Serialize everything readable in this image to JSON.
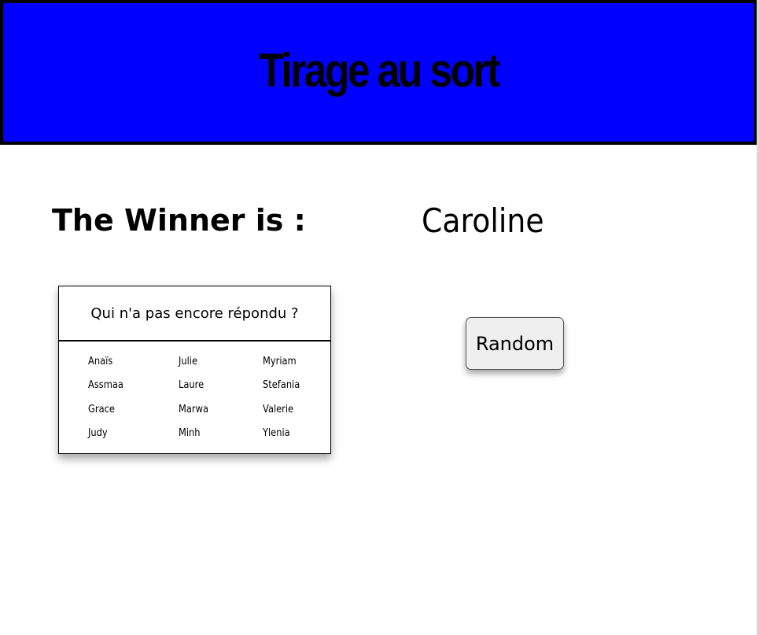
{
  "header": {
    "title": "Tirage au sort",
    "background_color": "#0000ff"
  },
  "winner": {
    "label": "The Winner is :",
    "name": "Caroline"
  },
  "pending_card": {
    "title": "Qui n'a pas encore répondu ?",
    "names": [
      "Anaïs",
      "Julie",
      "Myriam",
      "Assmaa",
      "Laure",
      "Stefania",
      "Grace",
      "Marwa",
      "Valerie",
      "Judy",
      "Minh",
      "Ylenia"
    ]
  },
  "random_button": {
    "label": "Random"
  }
}
